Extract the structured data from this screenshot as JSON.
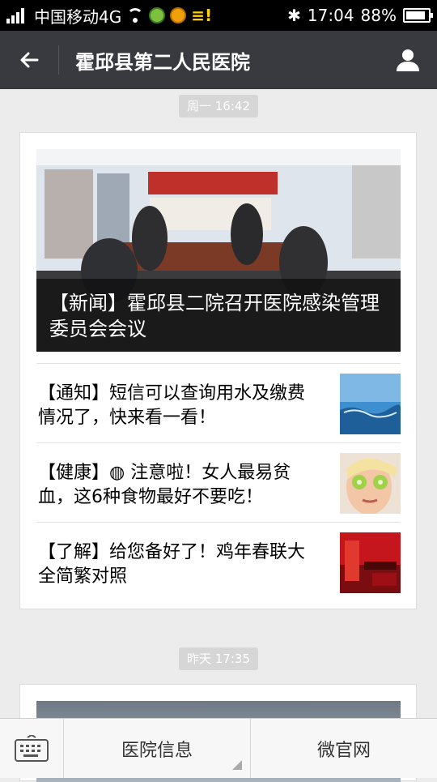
{
  "status_bar": {
    "carrier": "中国移动4G",
    "time": "17:04",
    "battery_percent": "88%",
    "battery_level": 0.88,
    "icons": [
      "signal-icon",
      "wifi-icon",
      "app-icon",
      "emoji-icon",
      "menu-icon",
      "bluetooth-icon",
      "battery-icon"
    ],
    "extra_mark": "≡!"
  },
  "header": {
    "title": "霍邱县第二人民医院",
    "back_icon": "back-arrow-icon",
    "profile_icon": "profile-icon"
  },
  "messages": [
    {
      "time": "周一 16:42",
      "headline": "【新闻】霍邱县二院召开医院感染管理委员会会议",
      "items": [
        {
          "title": "【通知】短信可以查询用水及缴费情况了，快来看一看！"
        },
        {
          "title": "【健康】◍ 注意啦！女人最易贫血，这6种食物最好不要吃！"
        },
        {
          "title": "【了解】给您备好了！鸡年春联大全简繁对照"
        }
      ]
    },
    {
      "time": "昨天 17:35"
    }
  ],
  "bottom_bar": {
    "keyboard_icon": "keyboard-icon",
    "menu1": "医院信息",
    "menu2": "微官网"
  },
  "colors": {
    "title_bar": "#393a3f",
    "background": "#ececec"
  }
}
